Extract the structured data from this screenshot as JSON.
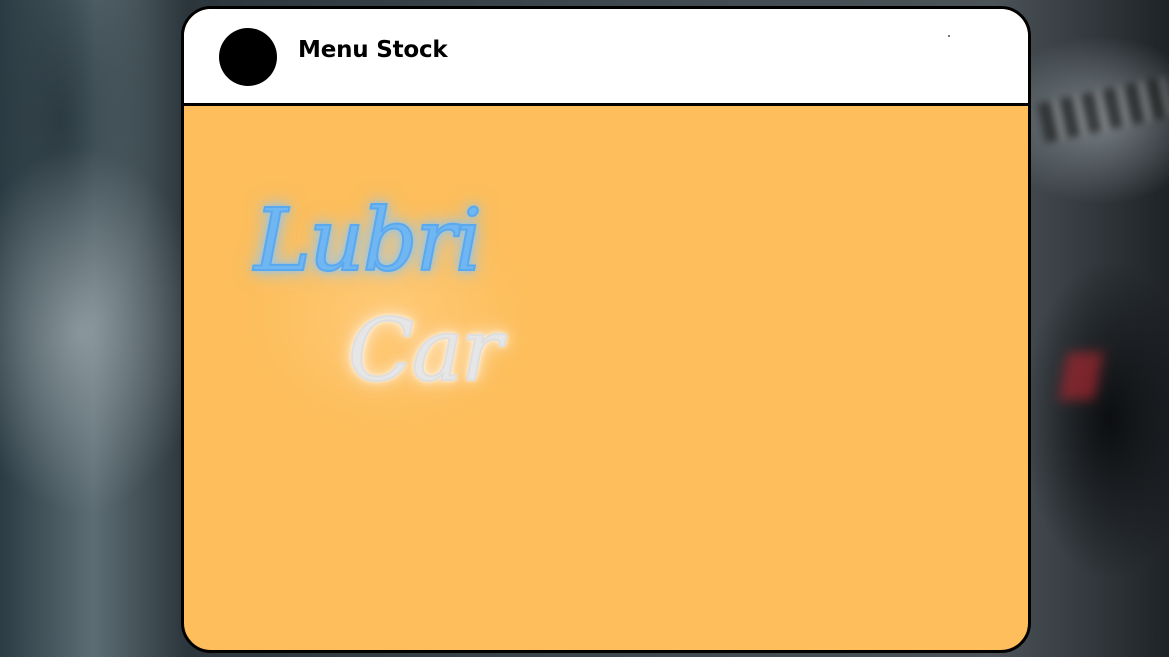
{
  "header": {
    "title": "Menu Stock"
  },
  "logo": {
    "line1": "Lubri",
    "line2": "Car",
    "line1_color": "#6fb6f2",
    "line2_color": "#e6e6e6"
  },
  "colors": {
    "panel_background": "#FDBE5B",
    "header_background": "#ffffff",
    "border": "#000000"
  }
}
